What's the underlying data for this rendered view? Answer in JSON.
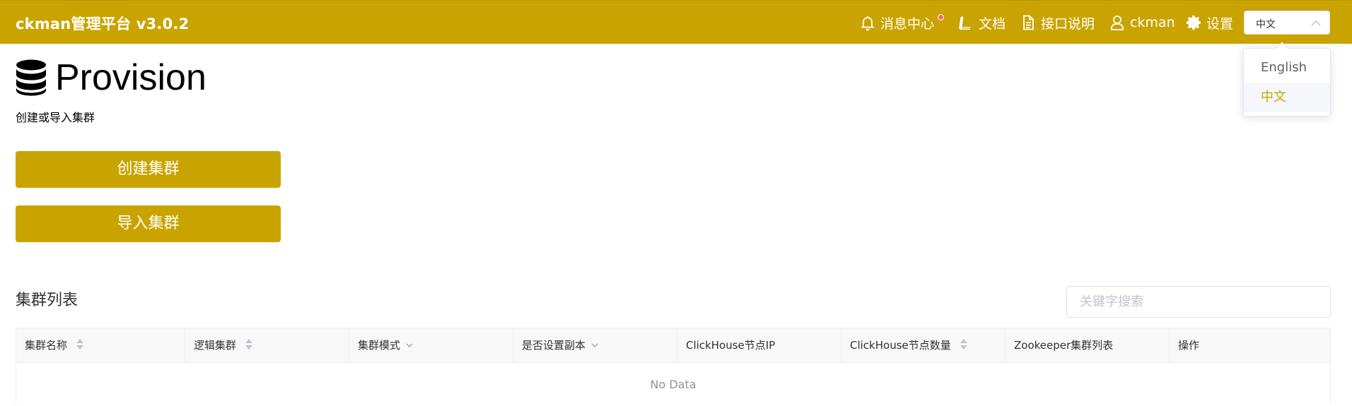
{
  "header": {
    "brand": "ckman管理平台 v3.0.2",
    "nav": {
      "messages": "消息中心",
      "docs": "文档",
      "api": "接口说明",
      "user": "ckman",
      "settings": "设置"
    },
    "language": {
      "selected": "中文",
      "options": [
        "English",
        "中文"
      ]
    },
    "accent": "#c9a400"
  },
  "page": {
    "title": "Provision",
    "subtitle": "创建或导入集群",
    "buttons": {
      "create": "创建集群",
      "import": "导入集群"
    }
  },
  "cluster_list": {
    "title": "集群列表",
    "search_placeholder": "关键字搜索",
    "columns": [
      "集群名称",
      "逻辑集群",
      "集群模式",
      "是否设置副本",
      "ClickHouse节点IP",
      "ClickHouse节点数量",
      "Zookeeper集群列表",
      "操作"
    ],
    "empty_text": "No Data"
  }
}
